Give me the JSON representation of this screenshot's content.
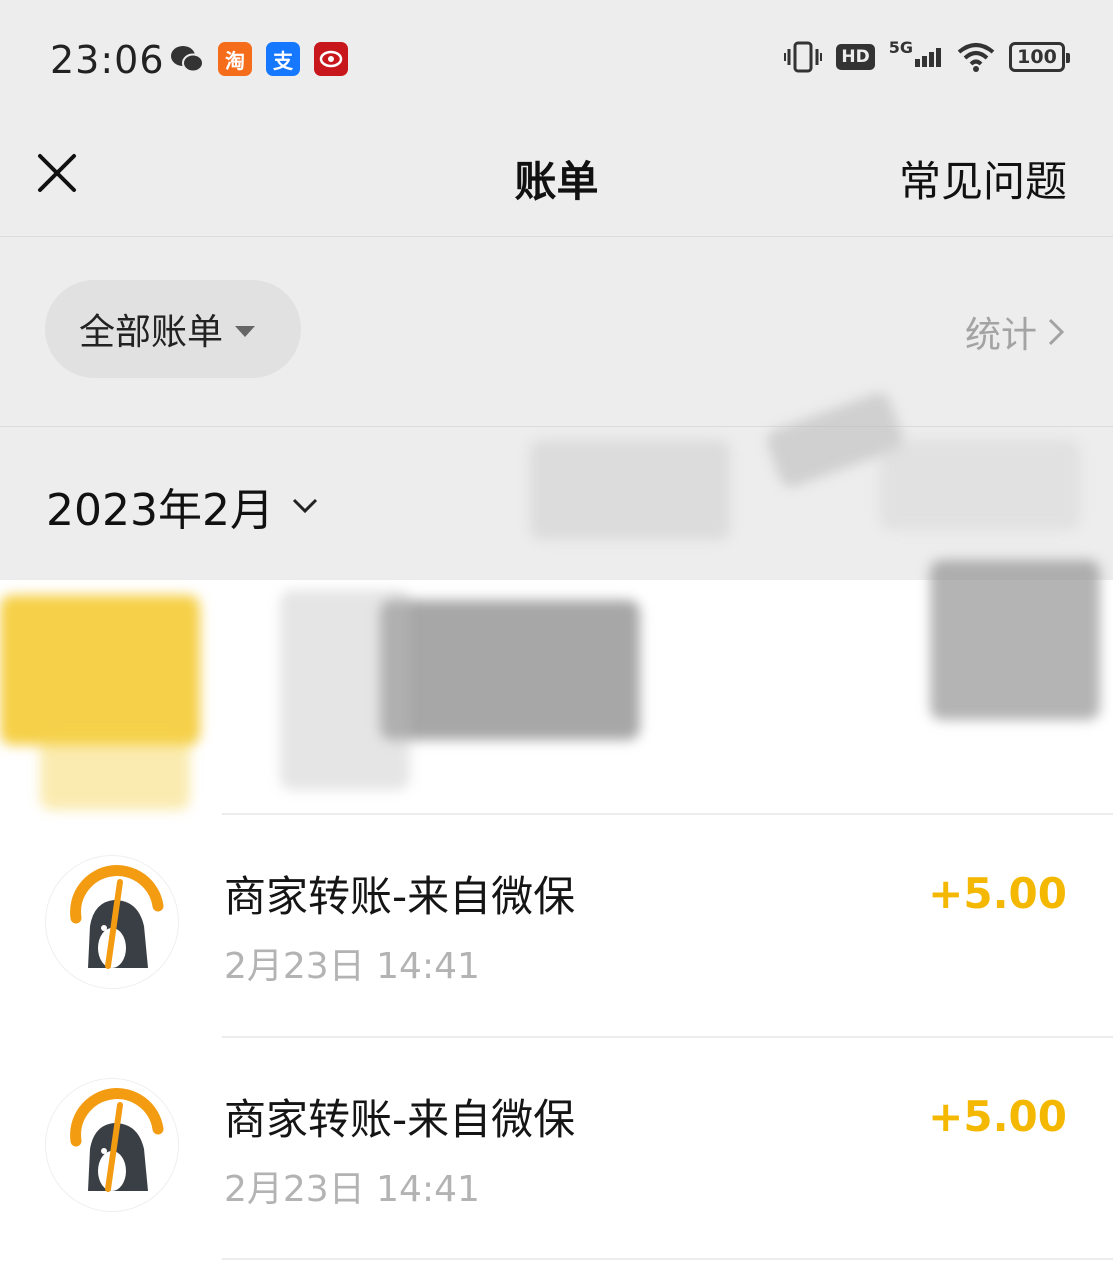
{
  "status_bar": {
    "time": "23:06",
    "battery": "100",
    "network": "5G",
    "hd": "HD",
    "notifications": [
      "wechat-icon",
      "taobao-icon",
      "alipay-icon",
      "app-icon"
    ],
    "taobao_glyph": "淘",
    "alipay_glyph": "支"
  },
  "nav": {
    "title": "账单",
    "faq": "常见问题"
  },
  "filter": {
    "label": "全部账单",
    "stats": "统计"
  },
  "month": {
    "label": "2023年2月"
  },
  "bills": [
    {
      "title": "商家转账-来自微保",
      "time": "2月23日 14:41",
      "amount": "+5.00"
    },
    {
      "title": "商家转账-来自微保",
      "time": "2月23日 14:41",
      "amount": "+5.00"
    }
  ],
  "colors": {
    "income": "#f5b800",
    "page_bg": "#ededed",
    "logo_orange": "#f39c12",
    "logo_dark": "#3a3f45"
  }
}
